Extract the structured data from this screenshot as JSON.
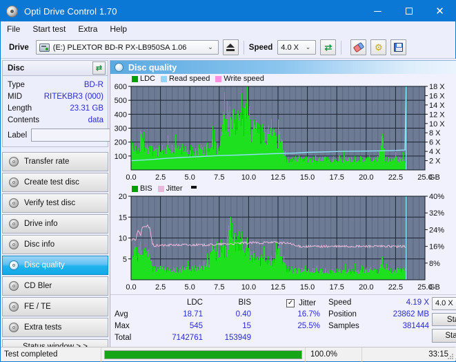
{
  "window": {
    "title": "Opti Drive Control 1.70",
    "icon": "disc-icon",
    "minimize": "–",
    "maximize": "□",
    "close": "✕"
  },
  "menu": {
    "items": [
      "File",
      "Start test",
      "Extra",
      "Help"
    ]
  },
  "toolbar": {
    "drive_label": "Drive",
    "drive_value": "(E:)   PLEXTOR BD-R  PX-LB950SA 1.06",
    "eject_title": "Eject",
    "speed_label": "Speed",
    "speed_value": "4.0 X",
    "refresh_title": "Refresh",
    "erase_title": "Erase",
    "tools_title": "Tools",
    "save_title": "Save",
    "caret": "⌄"
  },
  "disc_panel": {
    "title": "Disc",
    "refresh_glyph": "⇄",
    "rows": [
      {
        "key": "Type",
        "value": "BD-R"
      },
      {
        "key": "MID",
        "value": "RITEKBR3 (000)"
      },
      {
        "key": "Length",
        "value": "23.31 GB"
      },
      {
        "key": "Contents",
        "value": "data"
      }
    ],
    "label_key": "Label",
    "label_value": "",
    "label_placeholder": ""
  },
  "sidebar": {
    "items": [
      {
        "label": "Transfer rate",
        "selected": false
      },
      {
        "label": "Create test disc",
        "selected": false
      },
      {
        "label": "Verify test disc",
        "selected": false
      },
      {
        "label": "Drive info",
        "selected": false
      },
      {
        "label": "Disc info",
        "selected": false
      },
      {
        "label": "Disc quality",
        "selected": true
      },
      {
        "label": "CD Bler",
        "selected": false
      },
      {
        "label": "FE / TE",
        "selected": false
      },
      {
        "label": "Extra tests",
        "selected": false
      }
    ],
    "status_window": "Status window > >"
  },
  "card": {
    "title": "Disc quality",
    "icon": "disc-quality-icon"
  },
  "stats": {
    "col_headers": [
      "",
      "LDC",
      "BIS",
      "Jitter"
    ],
    "jitter_checked": true,
    "jitter_check_glyph": "✓",
    "rows": [
      {
        "label": "Avg",
        "ldc": "18.71",
        "bis": "0.40",
        "jitter": "16.7%"
      },
      {
        "label": "Max",
        "ldc": "545",
        "bis": "15",
        "jitter": "25.5%"
      },
      {
        "label": "Total",
        "ldc": "7142761",
        "bis": "153949",
        "jitter": ""
      }
    ],
    "info": [
      {
        "key": "Speed",
        "value": "4.19 X"
      },
      {
        "key": "Position",
        "value": "23862 MB"
      },
      {
        "key": "Samples",
        "value": "381444"
      }
    ],
    "speed_select": "4.0 X",
    "speed_caret": "⌄",
    "start_full": "Start full",
    "start_part": "Start part"
  },
  "statusbar": {
    "message": "Test completed",
    "progress_percent": 100.0,
    "progress_text": "100.0%",
    "elapsed": "33:15"
  },
  "colors": {
    "accent": "#0a78d4",
    "plot_bg": "#6d7b95",
    "ldc_green": "#1ee01e",
    "bis_green": "#1ee01e",
    "read_speed": "#8fe0f5",
    "write_speed": "#ff7fe0",
    "jitter_pink": "#e8b9da",
    "value_blue": "#2a2ad6",
    "progress_green": "#16a516"
  },
  "chart_data": [
    {
      "type": "area",
      "name": "ldc-chart",
      "title": "",
      "xlabel": "GB",
      "ylabel": "",
      "xlim": [
        0.0,
        25.0
      ],
      "ylim": [
        0,
        600
      ],
      "y2lim": [
        0,
        18
      ],
      "y2label": "X",
      "xticks": [
        "0.0",
        "2.5",
        "5.0",
        "7.5",
        "10.0",
        "12.5",
        "15.0",
        "17.5",
        "20.0",
        "22.5",
        "25.0"
      ],
      "yticks": [
        100,
        200,
        300,
        400,
        500,
        600
      ],
      "y2ticks": [
        "2 X",
        "4 X",
        "6 X",
        "8 X",
        "10 X",
        "12 X",
        "14 X",
        "16 X",
        "18 X"
      ],
      "grid": true,
      "legend": [
        {
          "label": "LDC",
          "color": "#00a000"
        },
        {
          "label": "Read speed",
          "color": "#8fd8f5"
        },
        {
          "label": "Write speed",
          "color": "#ff8fe0"
        }
      ],
      "series": [
        {
          "name": "LDC",
          "color": "#1ee01e",
          "x": [
            0.0,
            0.3,
            0.6,
            0.9,
            1.2,
            1.5,
            1.8,
            2.1,
            2.4,
            2.7,
            3.0,
            3.3,
            3.6,
            3.9,
            4.2,
            4.5,
            4.8,
            5.1,
            5.4,
            5.7,
            6.0,
            6.3,
            6.6,
            6.9,
            7.2,
            7.5,
            7.8,
            8.1,
            8.4,
            8.7,
            9.0,
            9.3,
            9.6,
            9.9,
            10.2,
            10.5,
            10.8,
            11.1,
            11.4,
            11.7,
            12.0,
            12.3,
            12.6,
            12.9,
            13.2,
            13.5,
            13.8,
            14.1,
            14.4,
            14.7,
            15.0,
            15.3,
            15.6,
            15.9,
            16.2,
            16.5,
            16.8,
            17.1,
            17.4,
            17.7,
            18.0,
            18.3,
            18.6,
            18.9,
            19.2,
            19.5,
            19.8,
            20.1,
            20.4,
            20.7,
            21.0,
            21.3,
            21.6,
            21.9,
            22.2,
            22.5,
            22.8,
            23.1,
            23.4
          ],
          "values": [
            275,
            185,
            170,
            345,
            175,
            160,
            165,
            160,
            170,
            175,
            165,
            160,
            170,
            165,
            175,
            170,
            165,
            175,
            170,
            170,
            175,
            180,
            180,
            300,
            180,
            185,
            370,
            420,
            440,
            470,
            415,
            545,
            400,
            520,
            300,
            340,
            330,
            300,
            300,
            290,
            300,
            250,
            280,
            230,
            90,
            90,
            90,
            95,
            90,
            95,
            90,
            90,
            95,
            95,
            90,
            95,
            95,
            95,
            90,
            95,
            95,
            90,
            95,
            95,
            95,
            95,
            90,
            95,
            95,
            95,
            95,
            300,
            95,
            95,
            95,
            95,
            95,
            95,
            90
          ]
        },
        {
          "name": "Read speed",
          "color": "#8fe0f5",
          "x": [
            0.0,
            1.5,
            3.0,
            4.5,
            6.0,
            7.5,
            9.0,
            10.5,
            12.0,
            13.5,
            14.0,
            15.0,
            16.5,
            18.0,
            19.5,
            21.0,
            22.5,
            23.3,
            23.4
          ],
          "values": [
            2.0,
            2.2,
            2.5,
            2.7,
            2.9,
            3.1,
            3.2,
            3.35,
            3.5,
            3.6,
            3.65,
            3.8,
            3.9,
            4.0,
            4.05,
            4.1,
            4.2,
            4.3,
            18.0
          ]
        }
      ]
    },
    {
      "type": "area",
      "name": "bis-jitter-chart",
      "title": "",
      "xlabel": "GB",
      "ylabel": "",
      "xlim": [
        0.0,
        25.0
      ],
      "ylim": [
        0,
        20
      ],
      "y2lim": [
        0,
        40
      ],
      "y2label": "%",
      "xticks": [
        "0.0",
        "2.5",
        "5.0",
        "7.5",
        "10.0",
        "12.5",
        "15.0",
        "17.5",
        "20.0",
        "22.5",
        "25.0"
      ],
      "yticks": [
        5,
        10,
        15,
        20
      ],
      "y2ticks": [
        "8%",
        "16%",
        "24%",
        "32%",
        "40%"
      ],
      "grid": true,
      "legend": [
        {
          "label": "BIS",
          "color": "#00a000"
        },
        {
          "label": "Jitter",
          "color": "#e8b9da"
        }
      ],
      "series": [
        {
          "name": "BIS",
          "color": "#1ee01e",
          "x": [
            0.0,
            0.3,
            0.6,
            0.9,
            1.2,
            1.5,
            1.8,
            2.1,
            2.4,
            2.7,
            3.0,
            3.3,
            3.6,
            3.9,
            4.2,
            4.5,
            4.8,
            5.1,
            5.4,
            5.7,
            6.0,
            6.3,
            6.6,
            6.9,
            7.2,
            7.5,
            7.8,
            8.1,
            8.4,
            8.7,
            9.0,
            9.3,
            9.6,
            9.9,
            10.2,
            10.5,
            10.8,
            11.1,
            11.4,
            11.7,
            12.0,
            12.3,
            12.6,
            12.9,
            13.2,
            13.5,
            13.8,
            14.1,
            14.4,
            14.7,
            15.0,
            15.3,
            15.6,
            15.9,
            16.2,
            16.5,
            16.8,
            17.1,
            17.4,
            17.7,
            18.0,
            18.3,
            18.6,
            18.9,
            19.2,
            19.5,
            19.8,
            20.1,
            20.4,
            20.7,
            21.0,
            21.3,
            21.6,
            21.9,
            22.2,
            22.5,
            22.8,
            23.1,
            23.4
          ],
          "values": [
            5.5,
            8.0,
            7.5,
            7.0,
            8.0,
            7.5,
            3.5,
            3.0,
            3.2,
            3.0,
            2.8,
            3.2,
            3.0,
            2.8,
            3.0,
            3.2,
            4.5,
            3.0,
            3.2,
            3.0,
            3.2,
            3.8,
            5.0,
            10.0,
            7.0,
            9.0,
            8.5,
            9.5,
            15.0,
            11.0,
            9.0,
            13.0,
            8.0,
            9.5,
            7.5,
            6.5,
            6.0,
            5.5,
            6.0,
            5.0,
            5.5,
            8.0,
            10.0,
            6.0,
            3.0,
            3.0,
            2.8,
            2.5,
            2.8,
            2.5,
            2.5,
            2.8,
            2.5,
            2.8,
            2.5,
            2.8,
            2.5,
            2.8,
            2.5,
            2.8,
            2.5,
            2.6,
            2.5,
            2.8,
            2.5,
            2.8,
            2.5,
            2.8,
            2.5,
            2.8,
            2.5,
            6.0,
            2.5,
            2.8,
            2.5,
            2.8,
            2.5,
            2.8,
            2.5
          ]
        },
        {
          "name": "Jitter",
          "color": "#e8b9da",
          "x": [
            0.0,
            0.2,
            0.4,
            0.6,
            0.8,
            1.0,
            1.2,
            1.4,
            1.6,
            1.8,
            2.0,
            2.5,
            3.0,
            3.5,
            4.0,
            4.5,
            5.0,
            5.5,
            6.0,
            6.5,
            7.0,
            7.5,
            8.0,
            8.5,
            9.0,
            9.5,
            10.0,
            10.5,
            11.0,
            11.5,
            12.0,
            12.5,
            13.0,
            13.5,
            14.0,
            14.5,
            15.0,
            16.0,
            17.0,
            18.0,
            19.0,
            20.0,
            21.0,
            22.0,
            23.0,
            23.4
          ],
          "values": [
            9.2,
            10.0,
            9.5,
            11.8,
            10.5,
            12.8,
            12.5,
            12.9,
            12.5,
            8.6,
            8.1,
            8.3,
            8.2,
            8.4,
            8.3,
            8.4,
            8.3,
            8.4,
            8.3,
            8.4,
            8.4,
            8.5,
            8.6,
            8.6,
            8.7,
            8.8,
            8.8,
            8.9,
            8.8,
            8.9,
            8.9,
            8.9,
            8.8,
            8.7,
            8.1,
            8.0,
            8.0,
            8.0,
            8.0,
            8.0,
            8.0,
            8.0,
            8.0,
            8.0,
            8.0,
            8.0
          ]
        }
      ]
    }
  ]
}
